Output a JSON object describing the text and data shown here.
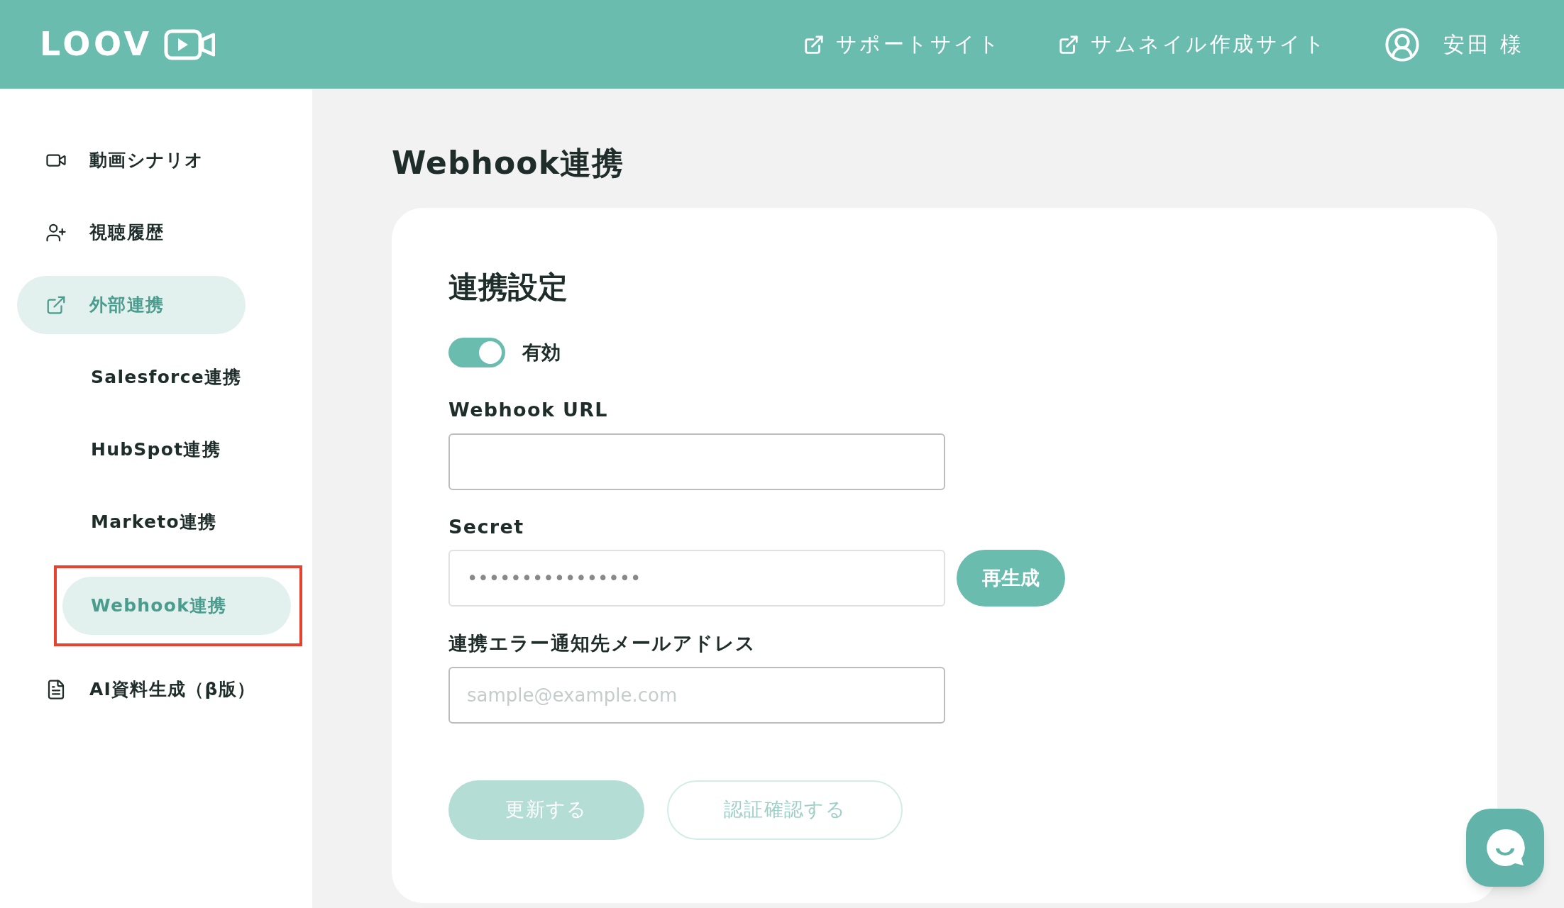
{
  "header": {
    "logo": "LOOV",
    "links": [
      {
        "label": "サポートサイト"
      },
      {
        "label": "サムネイル作成サイト"
      }
    ],
    "user": "安田 様"
  },
  "sidebar": {
    "items": [
      {
        "label": "動画シナリオ",
        "selected": false
      },
      {
        "label": "視聴履歴",
        "selected": false
      },
      {
        "label": "外部連携",
        "selected": true,
        "children": [
          {
            "label": "Salesforce連携",
            "selected": false
          },
          {
            "label": "HubSpot連携",
            "selected": false
          },
          {
            "label": "Marketo連携",
            "selected": false
          },
          {
            "label": "Webhook連携",
            "selected": true,
            "highlighted": true
          }
        ]
      },
      {
        "label": "AI資料生成（β版）",
        "selected": false
      }
    ]
  },
  "page": {
    "title": "Webhook連携",
    "section_title": "連携設定",
    "toggle": {
      "label": "有効",
      "on": true
    },
    "fields": [
      {
        "label": "Webhook URL"
      },
      {
        "label": "Secret",
        "value": "••••••••••••••••",
        "action": "再生成"
      },
      {
        "label": "連携エラー通知先メールアドレス",
        "placeholder": "sample@example.com"
      }
    ],
    "buttons": [
      {
        "label": "更新する",
        "kind": "primary",
        "disabled": true
      },
      {
        "label": "認証確認する",
        "kind": "secondary",
        "disabled": true
      }
    ]
  }
}
